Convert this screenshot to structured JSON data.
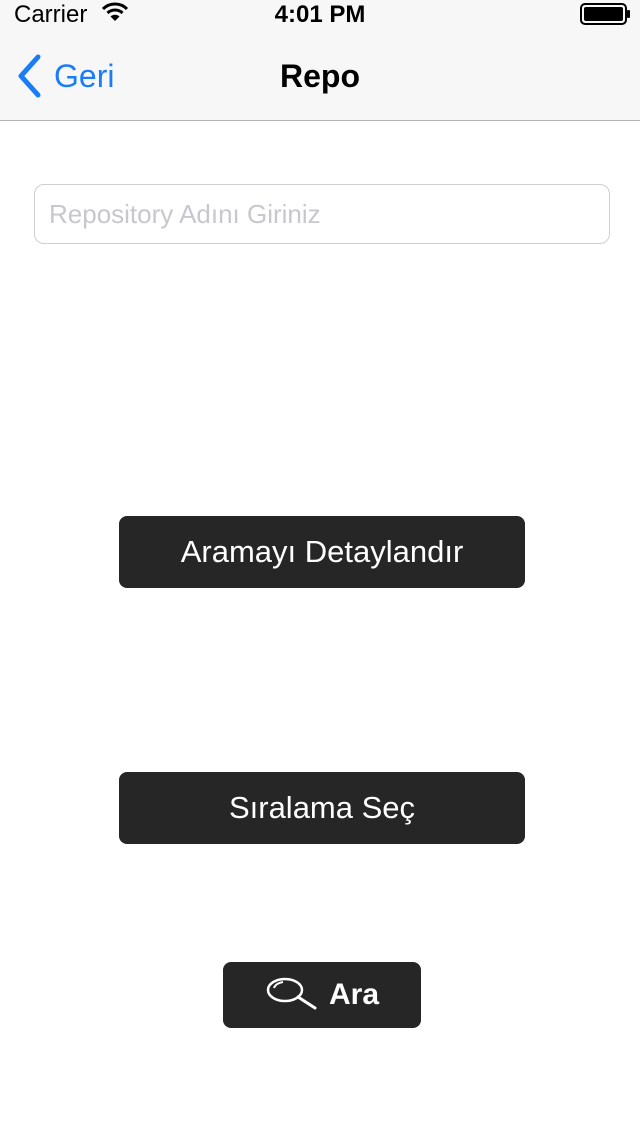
{
  "status_bar": {
    "carrier": "Carrier",
    "time": "4:01 PM",
    "icons": [
      "wifi-icon",
      "battery-icon"
    ]
  },
  "nav_bar": {
    "back_label": "Geri",
    "title": "Repo",
    "back_icon": "chevron-left-icon"
  },
  "search": {
    "placeholder": "Repository Adını Giriniz",
    "value": ""
  },
  "buttons": {
    "detail_label": "Aramayı Detaylandır",
    "sort_label": "Sıralama Seç",
    "search_label": "Ara",
    "search_icon": "magnifier-icon"
  },
  "colors": {
    "accent": "#1a7cf6",
    "button_bg": "#262626",
    "button_text": "#ffffff",
    "bar_bg": "#f7f7f7"
  }
}
